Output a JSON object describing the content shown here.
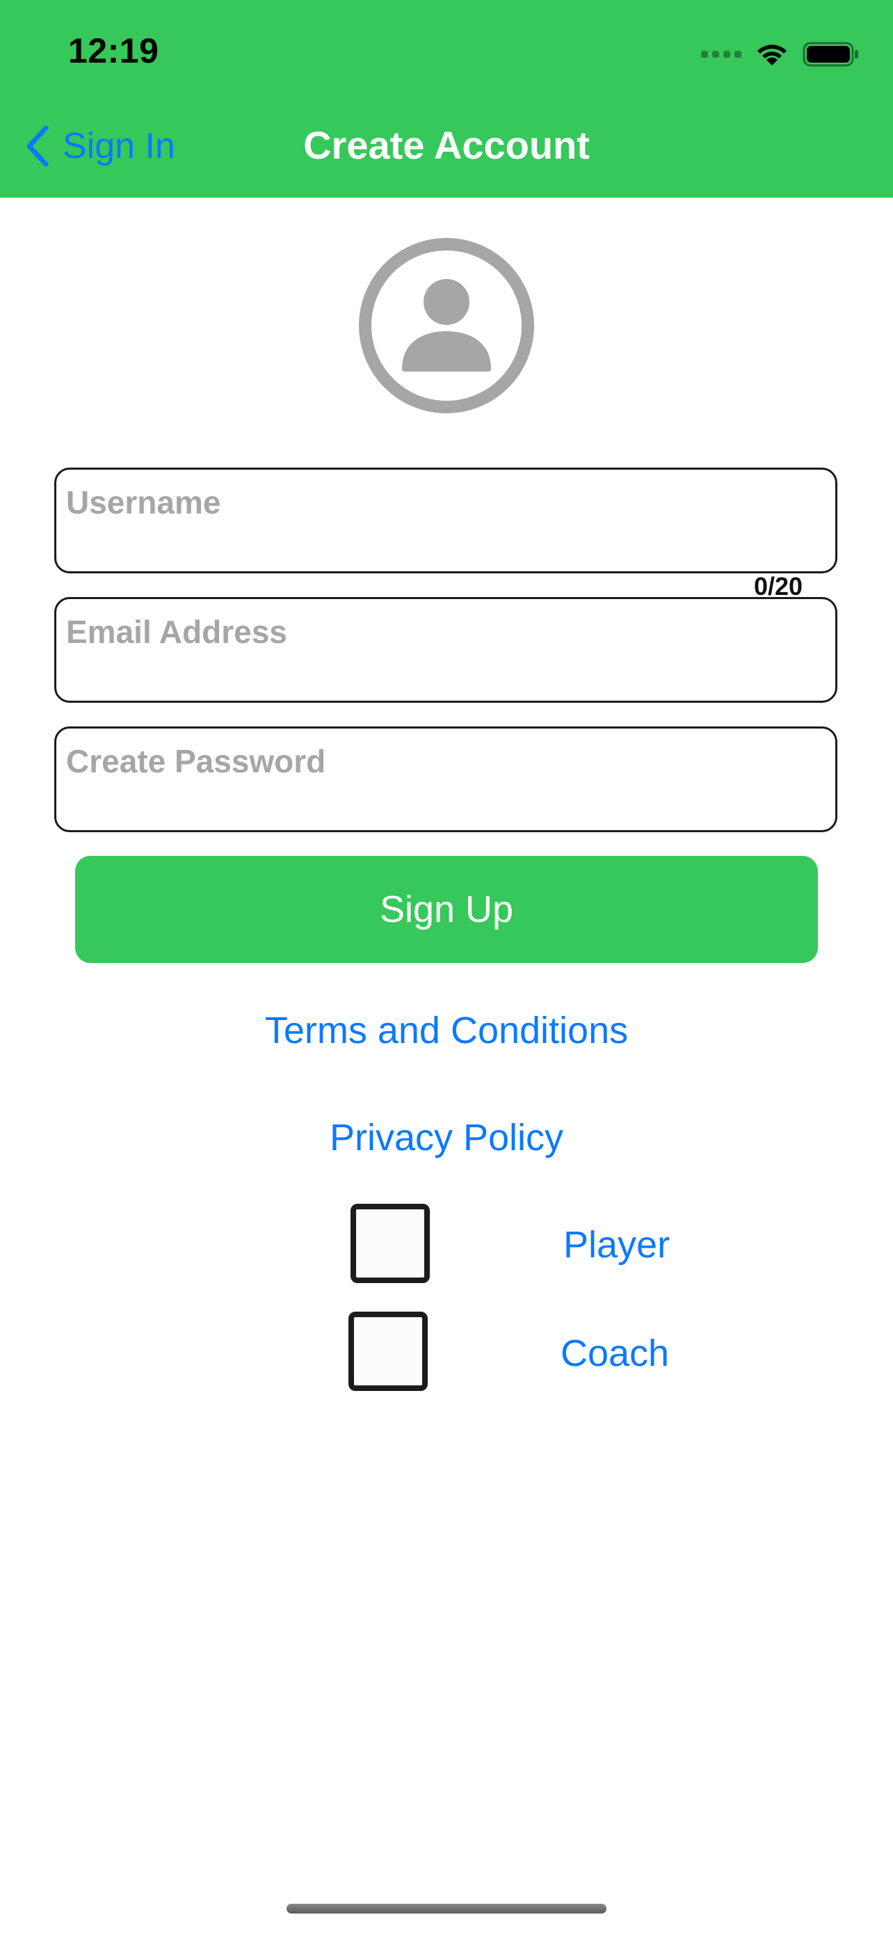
{
  "status_bar": {
    "time": "12:19",
    "icons": [
      "cellular-signal-icon",
      "wifi-icon",
      "battery-icon"
    ]
  },
  "nav_bar": {
    "back_label": "Sign In",
    "back_icon": "chevron-left-icon",
    "title": "Create Account",
    "background_color": "#36c85a"
  },
  "avatar": {
    "icon": "person-circle-icon",
    "color": "#a6a6a6"
  },
  "form": {
    "username": {
      "value": "",
      "placeholder": "Username",
      "char_count": "0/20"
    },
    "email": {
      "value": "",
      "placeholder": "Email Address"
    },
    "password": {
      "value": "",
      "placeholder": "Create Password"
    }
  },
  "actions": {
    "sign_up_label": "Sign Up",
    "terms_label": "Terms and Conditions",
    "privacy_label": "Privacy Policy"
  },
  "roles": [
    {
      "label": "Player",
      "checked": false
    },
    {
      "label": "Coach",
      "checked": false
    }
  ],
  "colors": {
    "accent_green": "#36c85a",
    "link_blue": "#0a7aff"
  }
}
